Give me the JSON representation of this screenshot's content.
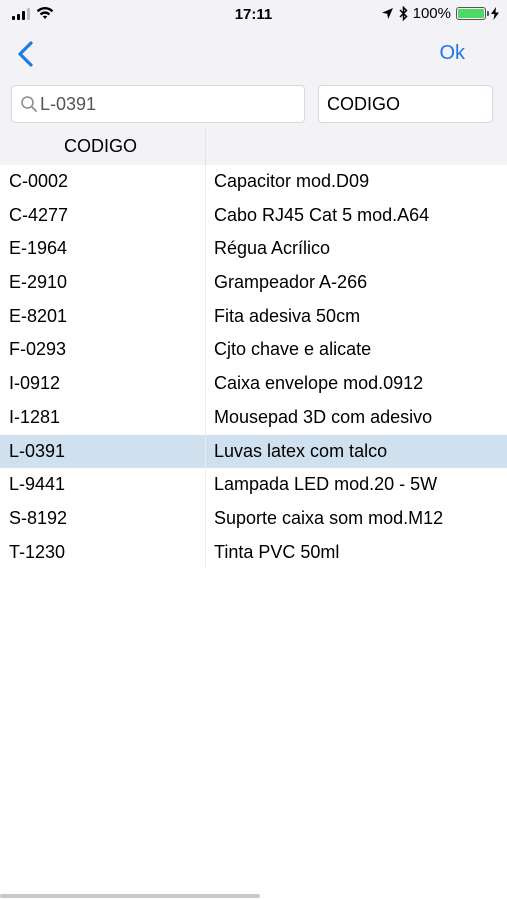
{
  "status_bar": {
    "time": "17:11",
    "battery_percent_label": "100%",
    "battery_level": 1.0,
    "icons": [
      "signal-icon",
      "wifi-icon",
      "location-icon",
      "bluetooth-icon",
      "battery-icon",
      "charging-icon"
    ]
  },
  "nav": {
    "back_icon": "chevron-left-icon",
    "ok_label": "Ok"
  },
  "search": {
    "value": "L-0391",
    "icon": "search-icon",
    "field_label": "CODIGO"
  },
  "table": {
    "header_code": "CODIGO",
    "header_desc": "",
    "rows": [
      {
        "code": "C-0002",
        "desc": "Capacitor mod.D09"
      },
      {
        "code": "C-4277",
        "desc": "Cabo RJ45 Cat 5 mod.A64"
      },
      {
        "code": "E-1964",
        "desc": "Régua Acrílico"
      },
      {
        "code": "E-2910",
        "desc": "Grampeador A-266"
      },
      {
        "code": "E-8201",
        "desc": "Fita adesiva 50cm"
      },
      {
        "code": "F-0293",
        "desc": "Cjto chave e alicate"
      },
      {
        "code": "I-0912",
        "desc": "Caixa envelope mod.0912"
      },
      {
        "code": "I-1281",
        "desc": "Mousepad 3D com adesivo"
      },
      {
        "code": "L-0391",
        "desc": "Luvas latex com talco"
      },
      {
        "code": "L-9441",
        "desc": "Lampada LED mod.20 - 5W"
      },
      {
        "code": "S-8192",
        "desc": "Suporte caixa som mod.M12"
      },
      {
        "code": "T-1230",
        "desc": "Tinta PVC 50ml"
      }
    ],
    "selected_index": 8
  },
  "colors": {
    "accent": "#1a7ae6",
    "selected_row": "#cfe0ee",
    "bar_background": "#f2f2f7",
    "battery_fill": "#4cd964"
  }
}
